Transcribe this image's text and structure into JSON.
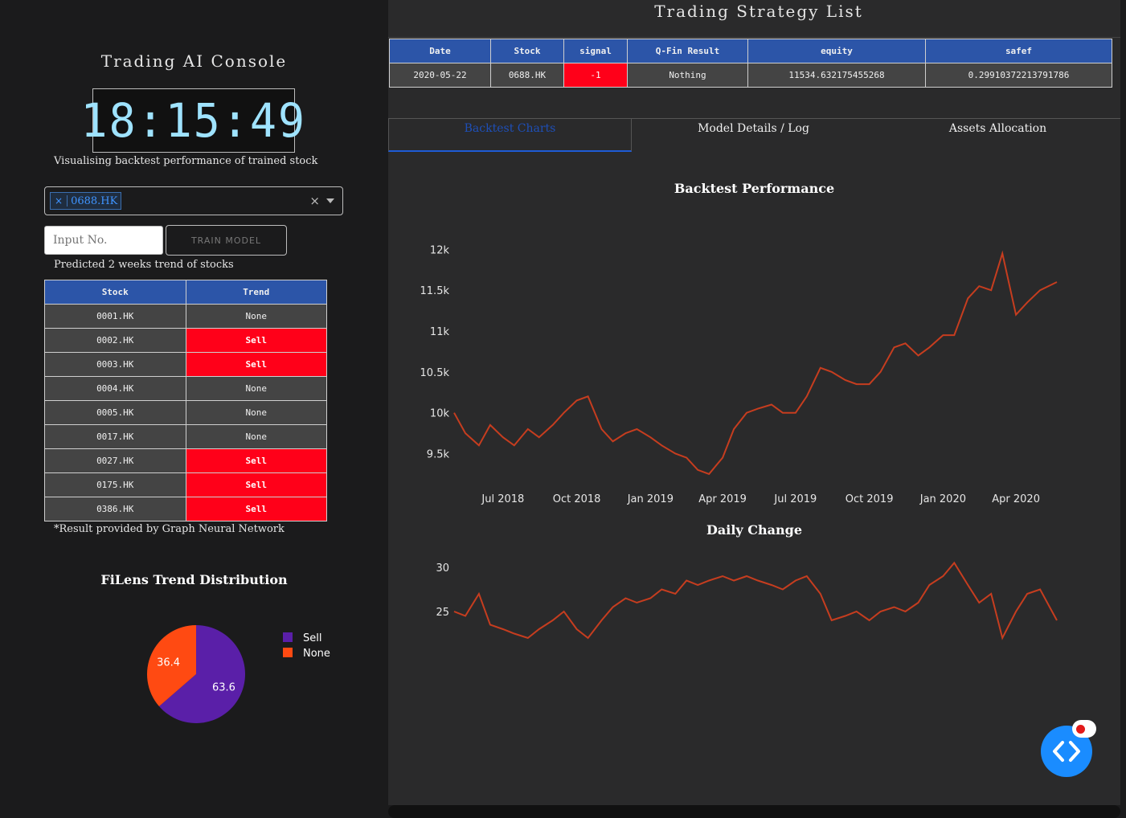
{
  "left": {
    "title": "Trading AI Console",
    "clock": "18:15:49",
    "subtitle": "Visualising backtest performance of trained stock",
    "dropdown": {
      "selected": "0688.HK",
      "remove": "×",
      "clear": "×"
    },
    "input": {
      "placeholder": "Input No."
    },
    "train_button": "TRAIN MODEL",
    "trend_caption": "Predicted 2 weeks trend of stocks",
    "trend_table": {
      "headers": [
        "Stock",
        "Trend"
      ],
      "rows": [
        [
          "0001.HK",
          "None"
        ],
        [
          "0002.HK",
          "Sell"
        ],
        [
          "0003.HK",
          "Sell"
        ],
        [
          "0004.HK",
          "None"
        ],
        [
          "0005.HK",
          "None"
        ],
        [
          "0017.HK",
          "None"
        ],
        [
          "0027.HK",
          "Sell"
        ],
        [
          "0175.HK",
          "Sell"
        ],
        [
          "0386.HK",
          "Sell"
        ]
      ]
    },
    "footnote": "*Result provided by Graph Neural Network",
    "pie_title": "FiLens Trend Distribution"
  },
  "right": {
    "title": "Trading Strategy List",
    "strategy_table": {
      "headers": [
        "Date",
        "Stock",
        "signal",
        "Q-Fin Result",
        "equity",
        "safef"
      ],
      "rows": [
        [
          "2020-05-22",
          "0688.HK",
          "-1",
          "Nothing",
          "11534.632175455268",
          "0.29910372213791786"
        ]
      ]
    },
    "tabs": [
      "Backtest Charts",
      "Model Details / Log",
      "Assets Allocation"
    ],
    "active_tab": 0
  },
  "chart_data": [
    {
      "type": "pie",
      "title": "FiLens Trend Distribution",
      "labels": [
        "Sell",
        "None"
      ],
      "values": [
        63.6,
        36.4
      ],
      "colors": [
        "#5a1fa8",
        "#ff4a12"
      ],
      "legend": "right"
    },
    {
      "type": "line",
      "title": "Backtest Performance",
      "color": "#c63d1f",
      "x": [
        "2018-05-01",
        "2018-05-15",
        "2018-06-01",
        "2018-06-15",
        "2018-07-01",
        "2018-07-15",
        "2018-08-01",
        "2018-08-15",
        "2018-09-01",
        "2018-09-15",
        "2018-10-01",
        "2018-10-15",
        "2018-11-01",
        "2018-11-15",
        "2018-12-01",
        "2018-12-15",
        "2019-01-01",
        "2019-01-15",
        "2019-02-01",
        "2019-02-15",
        "2019-03-01",
        "2019-03-15",
        "2019-04-01",
        "2019-04-15",
        "2019-05-01",
        "2019-05-15",
        "2019-06-01",
        "2019-06-15",
        "2019-07-01",
        "2019-07-15",
        "2019-08-01",
        "2019-08-15",
        "2019-09-01",
        "2019-09-15",
        "2019-10-01",
        "2019-10-15",
        "2019-11-01",
        "2019-11-15",
        "2019-12-01",
        "2019-12-15",
        "2020-01-01",
        "2020-01-15",
        "2020-02-01",
        "2020-02-15",
        "2020-03-01",
        "2020-03-15",
        "2020-04-01",
        "2020-04-15",
        "2020-05-01",
        "2020-05-22"
      ],
      "y": [
        10000,
        9750,
        9600,
        9850,
        9700,
        9600,
        9800,
        9700,
        9850,
        10000,
        10150,
        10200,
        9800,
        9650,
        9750,
        9800,
        9700,
        9600,
        9500,
        9450,
        9300,
        9250,
        9450,
        9800,
        10000,
        10050,
        10100,
        10000,
        10000,
        10200,
        10550,
        10500,
        10400,
        10350,
        10350,
        10500,
        10800,
        10850,
        10700,
        10800,
        10950,
        10950,
        11400,
        11550,
        11500,
        11950,
        11200,
        11350,
        11500,
        11600
      ],
      "yticks": [
        "9.5k",
        "10k",
        "10.5k",
        "11k",
        "11.5k",
        "12k"
      ],
      "ytick_values": [
        9500,
        10000,
        10500,
        11000,
        11500,
        12000
      ],
      "xticks": [
        "Jul 2018",
        "Oct 2018",
        "Jan 2019",
        "Apr 2019",
        "Jul 2019",
        "Oct 2019",
        "Jan 2020",
        "Apr 2020"
      ],
      "xtick_dates": [
        "2018-07-01",
        "2018-10-01",
        "2019-01-01",
        "2019-04-01",
        "2019-07-01",
        "2019-10-01",
        "2020-01-01",
        "2020-04-01"
      ],
      "ylim": [
        9200,
        12200
      ]
    },
    {
      "type": "line",
      "title": "Daily Change",
      "color": "#c63d1f",
      "x": [
        "2018-05-01",
        "2018-05-15",
        "2018-06-01",
        "2018-06-15",
        "2018-07-01",
        "2018-07-15",
        "2018-08-01",
        "2018-08-15",
        "2018-09-01",
        "2018-09-15",
        "2018-10-01",
        "2018-10-15",
        "2018-11-01",
        "2018-11-15",
        "2018-12-01",
        "2018-12-15",
        "2019-01-01",
        "2019-01-15",
        "2019-02-01",
        "2019-02-15",
        "2019-03-01",
        "2019-03-15",
        "2019-04-01",
        "2019-04-15",
        "2019-05-01",
        "2019-05-15",
        "2019-06-01",
        "2019-06-15",
        "2019-07-01",
        "2019-07-15",
        "2019-08-01",
        "2019-08-15",
        "2019-09-01",
        "2019-09-15",
        "2019-10-01",
        "2019-10-15",
        "2019-11-01",
        "2019-11-15",
        "2019-12-01",
        "2019-12-15",
        "2020-01-01",
        "2020-01-15",
        "2020-02-01",
        "2020-02-15",
        "2020-03-01",
        "2020-03-15",
        "2020-04-01",
        "2020-04-15",
        "2020-05-01",
        "2020-05-22"
      ],
      "y": [
        25,
        24.5,
        27,
        23.5,
        23,
        22.5,
        22,
        23,
        24,
        25,
        23,
        22,
        24,
        25.5,
        26.5,
        26,
        26.5,
        27.5,
        27,
        28.5,
        28,
        28.5,
        29,
        28.5,
        29,
        28.5,
        28,
        27.5,
        28.5,
        29,
        27,
        24,
        24.5,
        25,
        24,
        25,
        25.5,
        25,
        26,
        28,
        29,
        30.5,
        28,
        26,
        27,
        22,
        25,
        27,
        27.5,
        24
      ],
      "yticks": [
        "25",
        "30"
      ],
      "ytick_values": [
        25,
        30
      ],
      "ylim": [
        21,
        31
      ]
    }
  ],
  "colors": {
    "accent_blue": "#2c55a8",
    "sell_red": "#ff0019",
    "line": "#c63d1f",
    "clock": "#9fe3ff",
    "fab": "#1a8cff"
  },
  "fab": {
    "icon": "code-icon"
  }
}
